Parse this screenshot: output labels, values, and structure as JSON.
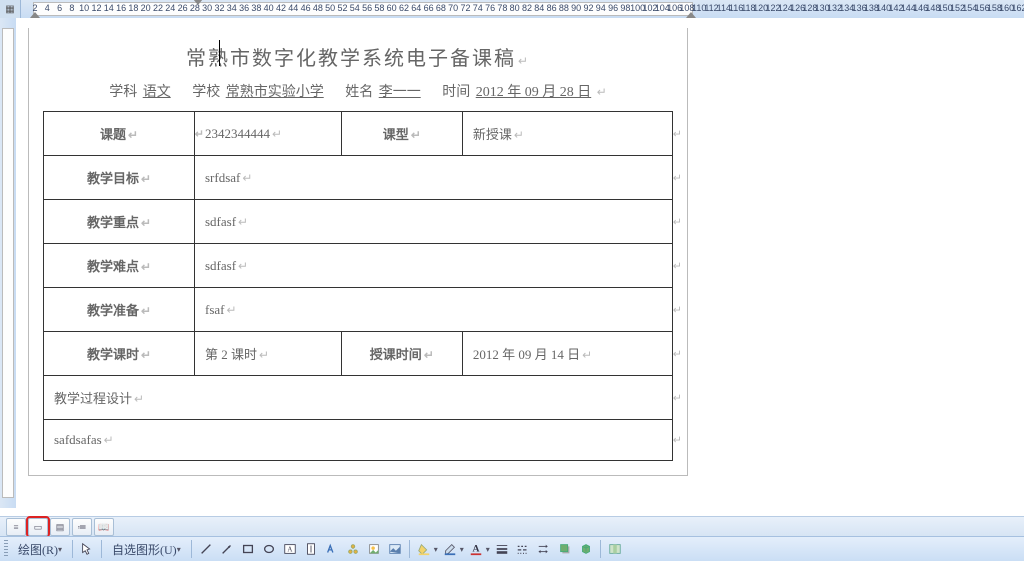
{
  "ruler": {
    "numbers": [
      2,
      4,
      6,
      8,
      10,
      12,
      14,
      16,
      18,
      20,
      22,
      24,
      26,
      28,
      30,
      32,
      34,
      36,
      38,
      40,
      42,
      44,
      46,
      48,
      50,
      52,
      54,
      56,
      58,
      60,
      62,
      64,
      66,
      68,
      70,
      72,
      74,
      76,
      78,
      80,
      82,
      84,
      86,
      88,
      90,
      92,
      94,
      96,
      98,
      100,
      102,
      104,
      106,
      108,
      110,
      112,
      114,
      116,
      118,
      120,
      122,
      124,
      126,
      128,
      130,
      132,
      134,
      136,
      138,
      140,
      142,
      144,
      146,
      148,
      150,
      152,
      154,
      156,
      158,
      160,
      162
    ]
  },
  "document": {
    "title": "常熟市数字化教学系统电子备课稿",
    "info": {
      "subject_label": "学科",
      "subject_value": "语文",
      "school_label": "学校",
      "school_value": "常熟市实验小学",
      "name_label": "姓名",
      "name_value": "李一一",
      "date_label": "时间",
      "date_value": "2012 年 09 月 28 日"
    },
    "rows": {
      "topic_label": "课题",
      "topic_value": "2342344444",
      "type_label": "课型",
      "type_value": "新授课",
      "goal_label": "教学目标",
      "goal_value": "srfdsaf",
      "keypoint_label": "教学重点",
      "keypoint_value": "sdfasf",
      "difficulty_label": "教学难点",
      "difficulty_value": "sdfasf",
      "prep_label": "教学准备",
      "prep_value": "fsaf",
      "hours_label": "教学课时",
      "hours_value": "第 2 课时",
      "teachtime_label": "授课时间",
      "teachtime_value": "2012 年 09 月 14 日",
      "process_label": "教学过程设计",
      "process_content": "safdsafas"
    }
  },
  "drawbar": {
    "draw_label": "绘图(R)",
    "autoshape_label": "自选图形(U)"
  }
}
